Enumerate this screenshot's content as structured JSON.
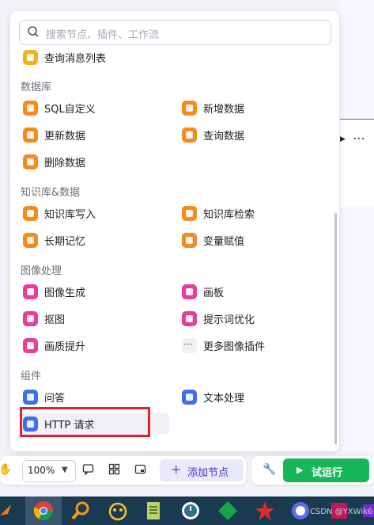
{
  "search": {
    "placeholder": "搜索节点、插件、工作流"
  },
  "partial_item": {
    "label": "查询消息列表"
  },
  "sections": {
    "database": "数据库",
    "knowledge": "知识库&数据",
    "image": "图像处理",
    "component": "组件"
  },
  "items": {
    "sql": "SQL自定义",
    "add_data": "新增数据",
    "update_data": "更新数据",
    "query_data": "查询数据",
    "delete_data": "删除数据",
    "kb_write": "知识库写入",
    "kb_search": "知识库检索",
    "long_memory": "长期记忆",
    "var_assign": "变量赋值",
    "image_gen": "图像生成",
    "canvas": "画板",
    "cutout": "抠图",
    "prompt_opt": "提示词优化",
    "quality_up": "画质提升",
    "more_image": "更多图像插件",
    "qa": "问答",
    "text_proc": "文本处理",
    "http": "HTTP 请求"
  },
  "toolbar": {
    "zoom": "100%",
    "add_node": "添加节点",
    "run": "试运行"
  },
  "watermark": "CSDN @YXWik6",
  "colors": {
    "accent": "#5350e6",
    "run": "#18b65a",
    "orange": "#f58a1f",
    "highlight": "#e0202a"
  }
}
